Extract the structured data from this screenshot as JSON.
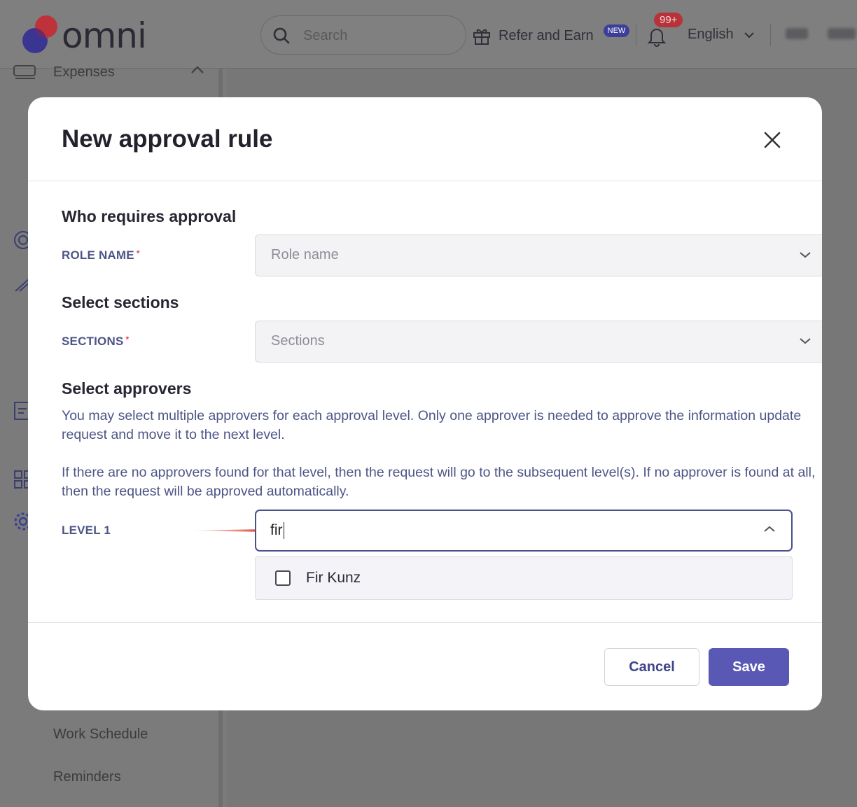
{
  "app": {
    "logo_text": "omni",
    "search_placeholder": "Search",
    "refer_label": "Refer and Earn",
    "new_badge": "NEW",
    "notification_count": "99+",
    "language": "English"
  },
  "sidebar": {
    "expenses": "Expenses",
    "work_schedule": "Work Schedule",
    "reminders": "Reminders"
  },
  "modal": {
    "title": "New approval rule",
    "who_requires_approval": "Who requires approval",
    "role_name_label": "ROLE NAME",
    "role_name_placeholder": "Role name",
    "select_sections": "Select sections",
    "sections_label": "SECTIONS",
    "sections_placeholder": "Sections",
    "select_approvers": "Select approvers",
    "desc_1": "You may select multiple approvers for each approval level. Only one approver is needed to approve the information update request and move it to the next level.",
    "desc_2": "If there are no approvers found for that level, then the request will go to the subsequent level(s). If no approver is found at all, then the request will be approved automatically.",
    "level_label": "LEVEL 1",
    "level_value": "fir",
    "options": [
      "Fir Kunz"
    ],
    "cancel_label": "Cancel",
    "save_label": "Save",
    "required_mark": "*"
  },
  "colors": {
    "accent": "#5a58b5",
    "label": "#4d5586",
    "required": "#e04a5a",
    "arrow": "#e04a3a"
  }
}
